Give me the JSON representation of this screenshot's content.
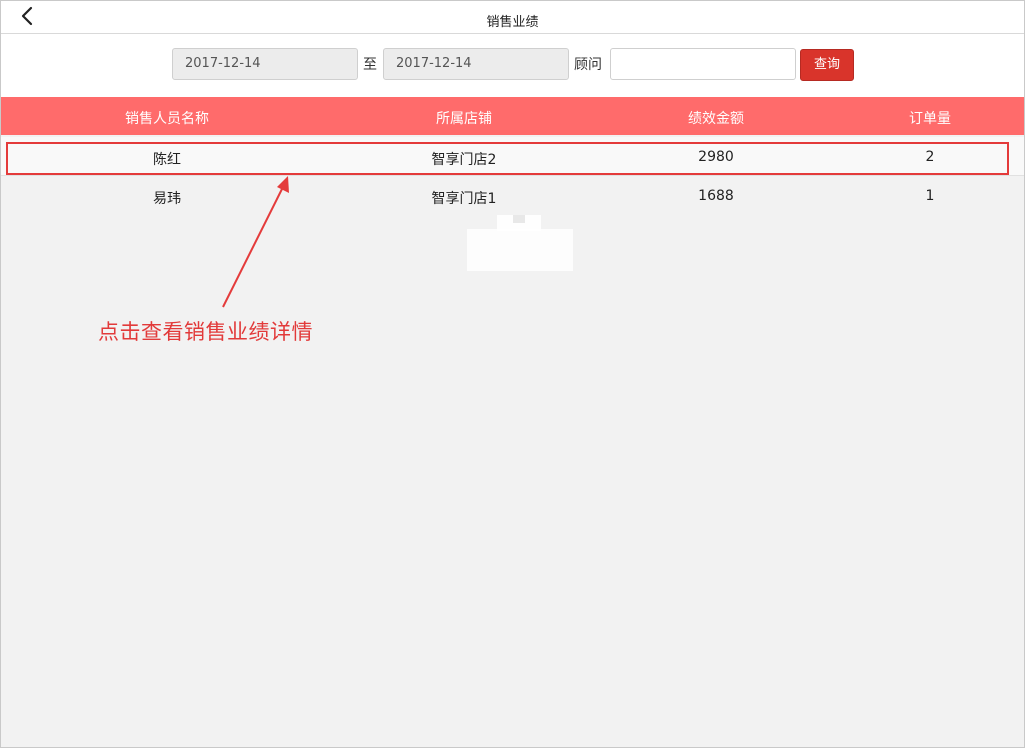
{
  "header": {
    "title": "销售业绩",
    "back_icon": "chevron-left-icon"
  },
  "filters": {
    "start_date": "2017-12-14",
    "separator": "至",
    "end_date": "2017-12-14",
    "advisor_label": "顾问",
    "advisor_value": "",
    "query_label": "查询"
  },
  "table": {
    "columns": [
      "销售人员名称",
      "所属店铺",
      "绩效金额",
      "订单量"
    ],
    "rows": [
      [
        "陈红",
        "智享门店2",
        "2980",
        "2"
      ],
      [
        "易玮",
        "智享门店1",
        "1688",
        "1"
      ]
    ]
  },
  "annotation": {
    "note": "点击查看销售业绩详情"
  },
  "colors": {
    "header_bg": "#ff6b6b",
    "button_bg": "#d9342b",
    "annotation": "#e23a3a",
    "page_bg": "#f2f2f2"
  }
}
